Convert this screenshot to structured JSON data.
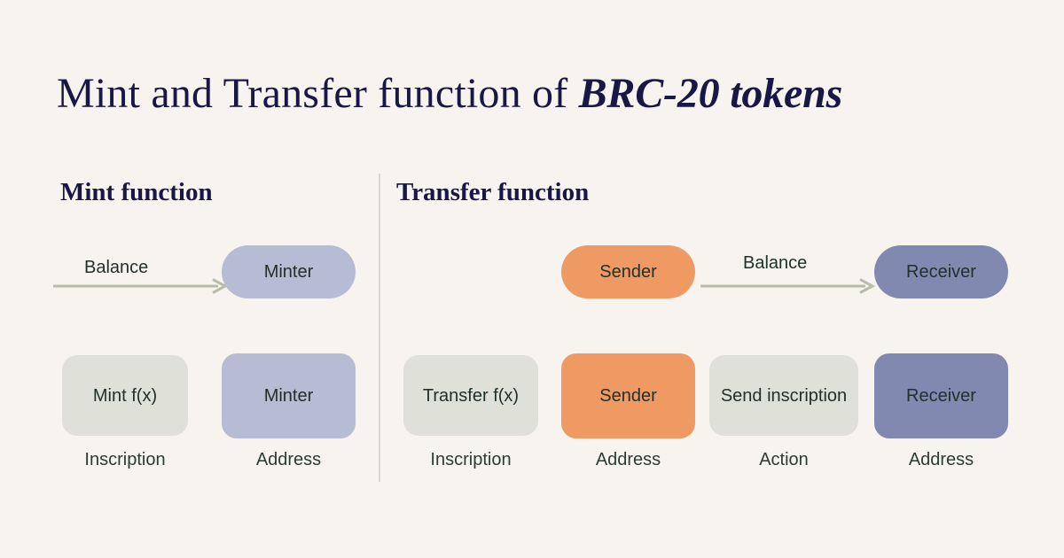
{
  "background_color": "#f7f3ee",
  "title": {
    "plain": "Mint and Transfer function of ",
    "accent": "BRC-20 tokens",
    "color": "#181745"
  },
  "palette": {
    "navy": "#181745",
    "lilac": "#b5bcd3",
    "indigo": "#8289b0",
    "sage": "#dfe0d8",
    "orange": "#ef9a63",
    "arrow": "#b8bcab",
    "divider": "#d9d5ca",
    "caption_text": "#2d3b36",
    "node_text": "#22302c"
  },
  "mint_section": {
    "heading": "Mint function",
    "flow_row": {
      "arrow_label": "Balance",
      "arrow_name": "balance-arrow-right",
      "target_node": "Minter"
    },
    "schema_row": [
      {
        "node": "Mint f(x)",
        "caption": "Inscription",
        "fill": "sage"
      },
      {
        "node": "Minter",
        "caption": "Address",
        "fill": "lilac"
      }
    ]
  },
  "transfer_section": {
    "heading": "Transfer function",
    "flow_row": {
      "source_node": "Sender",
      "arrow_label": "Balance",
      "arrow_name": "balance-arrow-right",
      "target_node": "Receiver"
    },
    "schema_row": [
      {
        "node": "Transfer f(x)",
        "caption": "Inscription",
        "fill": "sage"
      },
      {
        "node": "Sender",
        "caption": "Address",
        "fill": "orange"
      },
      {
        "node": "Send inscription",
        "caption": "Action",
        "fill": "sage"
      },
      {
        "node": "Receiver",
        "caption": "Address",
        "fill": "indigo"
      }
    ]
  }
}
